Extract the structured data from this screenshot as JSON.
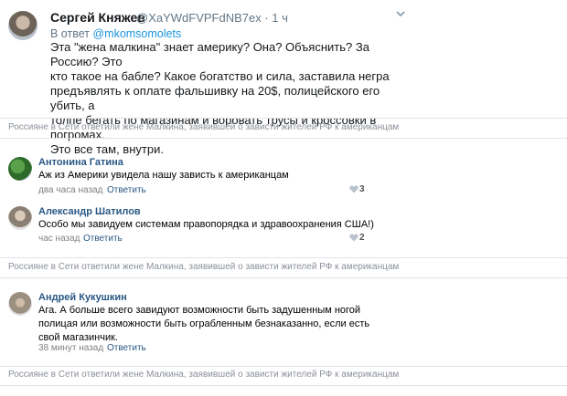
{
  "tweet": {
    "author_name": "Сергей Княжев",
    "author_handle": "@XaYWdFVPFdNB7ex · 1 ч",
    "reply_prefix": "В ответ",
    "reply_target": "@mkomsomolets",
    "text_lines": [
      "Эта \"жена малкина\" знает америку? Она? Объяснить? За Россию?  Это",
      "кто такое на бабле? Какое богатство и сила,  заставила негра",
      "предъявлять к оплате фальшивку на 20$, полицейского его убить, а",
      "толпе бегать по магазинам и воровать трусы и кроссовки в погромах.",
      "Это все там, внутри."
    ]
  },
  "section_title": "Россияне в Сети ответили жене Малкина, заявившей о зависти жителей РФ к американцам",
  "comments": [
    {
      "name": "Антонина Гатина",
      "text_lines": [
        "Аж из Америки увидела нашу зависть к американцам"
      ],
      "time": "два часа назад",
      "reply_label": "Ответить",
      "likes": "3"
    },
    {
      "name": "Александр Шатилов",
      "text_lines": [
        "Особо мы завидуем системам правопорядка и здравоохранения США!)"
      ],
      "time": "час назад",
      "reply_label": "Ответить",
      "likes": "2"
    },
    {
      "name": "Андрей Кукушкин",
      "text_lines": [
        "Ага. А больше всего завидуют возможности быть задушенным ногой",
        "полицая или возможности быть ограбленным безнаказанно, если есть",
        "свой магазинчик."
      ],
      "time": "38 минут назад",
      "reply_label": "Ответить",
      "likes": ""
    }
  ],
  "colors": {
    "link_blue": "#1b95e0",
    "vk_name_blue": "#2a5885",
    "divider": "#dfe3e8"
  },
  "icons": [
    "chevron-down-icon",
    "heart-icon"
  ]
}
